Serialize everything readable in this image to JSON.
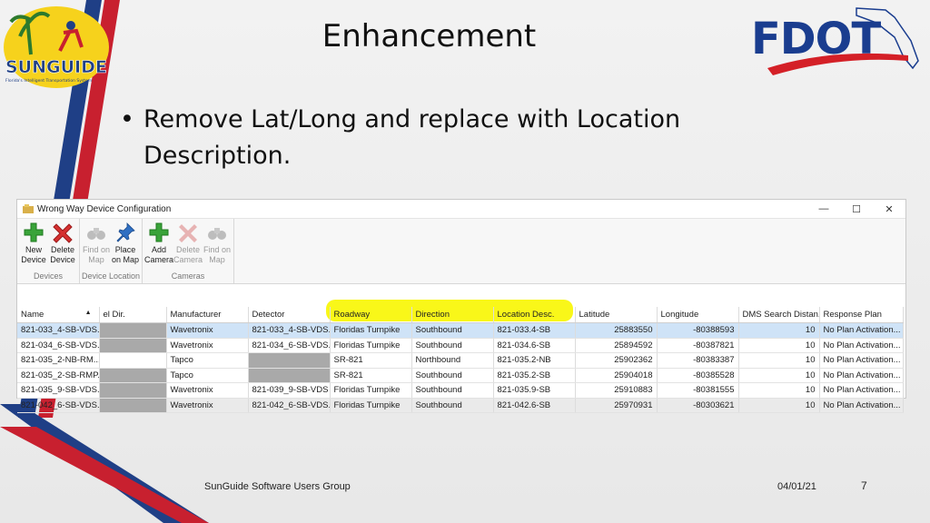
{
  "slide": {
    "title": "Enhancement",
    "bullet": "Remove Lat/Long and replace with Location Description.",
    "bullet_symbol": "•",
    "footer_left": "SunGuide Software Users Group",
    "footer_date": "04/01/21",
    "page_number": "7"
  },
  "logos": {
    "left_text": "SUNGUIDE",
    "left_subtext": "Florida's Intelligent Transportation System",
    "right_text": "FDOT"
  },
  "colors": {
    "stripe_red": "#c8202f",
    "stripe_blue": "#1f3f86",
    "fdot_blue": "#1a3d8f",
    "fdot_red": "#d42027",
    "highlight": "#f8f600",
    "selected_row": "#cfe3f7",
    "grey_cell": "#a9a9a9"
  },
  "window": {
    "title": "Wrong Way Device Configuration",
    "controls": [
      "—",
      "☐",
      "✕"
    ],
    "ribbon_groups": [
      {
        "label": "Devices",
        "buttons": [
          {
            "label": "New Device",
            "icon": "plus-icon",
            "enabled": true
          },
          {
            "label": "Delete Device",
            "icon": "x-icon",
            "enabled": true
          }
        ]
      },
      {
        "label": "Device Location",
        "buttons": [
          {
            "label": "Find on Map",
            "icon": "binoculars-icon",
            "enabled": false
          },
          {
            "label": "Place on Map",
            "icon": "pushpin-icon",
            "enabled": true
          }
        ]
      },
      {
        "label": "Cameras",
        "buttons": [
          {
            "label": "Add Camera",
            "icon": "plus-icon",
            "enabled": true
          },
          {
            "label": "Delete Camera",
            "icon": "x-icon",
            "enabled": false
          },
          {
            "label": "Find on Map",
            "icon": "binoculars-icon",
            "enabled": false
          }
        ]
      }
    ]
  },
  "table": {
    "columns": [
      "Name",
      "el Dir.",
      "Manufacturer",
      "Detector",
      "Roadway",
      "Direction",
      "Location Desc.",
      "Latitude",
      "Longitude",
      "DMS Search Distan...",
      "Response Plan"
    ],
    "sort_indicator": "▲",
    "rows": [
      [
        "821-033_4-SB-VDS...",
        "",
        "Wavetronix",
        "821-033_4-SB-VDS...",
        "Floridas Turnpike",
        "Southbound",
        "821-033.4-SB",
        "25883550",
        "-80388593",
        "10",
        "No Plan Activation..."
      ],
      [
        "821-034_6-SB-VDS...",
        "",
        "Wavetronix",
        "821-034_6-SB-VDS...",
        "Floridas Turnpike",
        "Southbound",
        "821-034.6-SB",
        "25894592",
        "-80387821",
        "10",
        "No Plan Activation..."
      ],
      [
        "821-035_2-NB-RM...",
        "",
        "Tapco",
        "",
        "SR-821",
        "Northbound",
        "821-035.2-NB",
        "25902362",
        "-80383387",
        "10",
        "No Plan Activation..."
      ],
      [
        "821-035_2-SB-RMP...",
        "",
        "Tapco",
        "",
        "SR-821",
        "Southbound",
        "821-035.2-SB",
        "25904018",
        "-80385528",
        "10",
        "No Plan Activation..."
      ],
      [
        "821-035_9-SB-VDS...",
        "",
        "Wavetronix",
        "821-039_9-SB-VDS",
        "Floridas Turnpike",
        "Southbound",
        "821-035.9-SB",
        "25910883",
        "-80381555",
        "10",
        "No Plan Activation..."
      ],
      [
        "821-042_6-SB-VDS...",
        "",
        "Wavetronix",
        "821-042_6-SB-VDS...",
        "Floridas Turnpike",
        "Southbound",
        "821-042.6-SB",
        "25970931",
        "-80303621",
        "10",
        "No Plan Activation..."
      ]
    ]
  }
}
